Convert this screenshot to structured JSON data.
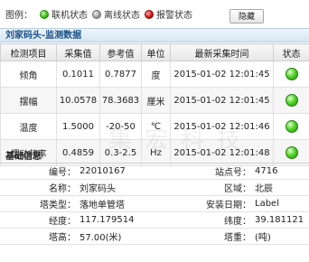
{
  "legend": {
    "label": "图例：",
    "items": [
      {
        "label": "联机状态",
        "color": "green"
      },
      {
        "label": "离线状态",
        "color": "gray"
      },
      {
        "label": "报警状态",
        "color": "red"
      }
    ],
    "hide_button": "隐藏"
  },
  "monitor": {
    "title": "刘家码头-监测数据",
    "columns": [
      "检测项目",
      "采集值",
      "参考值",
      "单位",
      "最新采集时间",
      "状态"
    ],
    "rows": [
      {
        "item": "倾角",
        "value": "0.1011",
        "ref": "0.7877",
        "unit": "度",
        "time": "2015-01-02 12:01:45"
      },
      {
        "item": "摆幅",
        "value": "10.0578",
        "ref": "78.3683",
        "unit": "厘米",
        "time": "2015-01-02 12:01:45"
      },
      {
        "item": "温度",
        "value": "1.5000",
        "ref": "-20-50",
        "unit": "℃",
        "time": "2015-01-02 12:01:46"
      },
      {
        "item": "摆动频率",
        "value": "0.4859",
        "ref": "0.3-2.5",
        "unit": "Hz",
        "time": "2015-01-02 12:01:48"
      }
    ],
    "status_color": "#3fbf1c"
  },
  "watermark": "集宏科技",
  "base": {
    "title": "基础信息",
    "rows": [
      {
        "k1": "编号：",
        "v1": "22010167",
        "k2": "站点号：",
        "v2": "4716"
      },
      {
        "k1": "名称：",
        "v1": "刘家码头",
        "k2": "区域：",
        "v2": "北辰"
      },
      {
        "k1": "塔类型：",
        "v1": "落地单管塔",
        "k2": "安装日期：",
        "v2": "Label"
      },
      {
        "k1": "经度：",
        "v1": "117.179514",
        "k2": "纬度：",
        "v2": "39.181121"
      },
      {
        "k1": "塔高：",
        "v1": "57.00(米)",
        "k2": "塔重：",
        "v2": "(吨)"
      }
    ]
  }
}
